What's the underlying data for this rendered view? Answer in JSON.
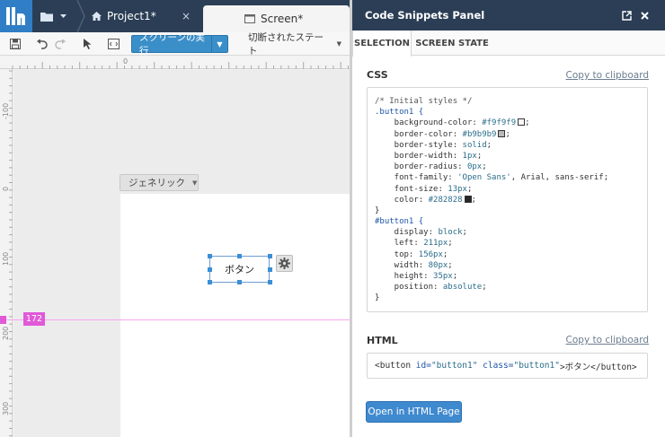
{
  "app": {
    "project_tab": "Project1*",
    "screen_tab": "Screen*",
    "close_glyph": "×"
  },
  "toolbar": {
    "run_label": "スクリーンの実行",
    "state_label": "切断されたステート"
  },
  "canvas": {
    "ruler_top_zero": "0",
    "ruler_left_labels": [
      "-100",
      "0",
      "100",
      "200",
      "300"
    ],
    "device_dropdown": "ジェネリック",
    "button_text": "ボタン",
    "guide_value": "172"
  },
  "panel": {
    "title": "Code Snippets Panel",
    "tabs": [
      "SELECTION",
      "SCREEN STATE"
    ],
    "css_title": "CSS",
    "html_title": "HTML",
    "copy_label": "Copy to clipboard",
    "open_label": "Open in HTML Page",
    "css_lines": [
      {
        "kind": "comment",
        "text": "/* Initial styles */"
      },
      {
        "kind": "selector",
        "text": ".button1 {"
      },
      {
        "kind": "decl",
        "prop": "    background-color: ",
        "value": "#f9f9f9",
        "swatch": "#f9f9f9",
        "end": ";"
      },
      {
        "kind": "decl",
        "prop": "    border-color: ",
        "value": "#b9b9b9",
        "swatch": "#b9b9b9",
        "end": ";"
      },
      {
        "kind": "decl",
        "prop": "    border-style: ",
        "value": "solid",
        "end": ";"
      },
      {
        "kind": "decl",
        "prop": "    border-width: ",
        "value": "1px",
        "end": ";"
      },
      {
        "kind": "decl",
        "prop": "    border-radius: ",
        "value": "0px",
        "end": ";"
      },
      {
        "kind": "decl",
        "prop": "    font-family: ",
        "value": "'Open Sans'",
        "tail": ", Arial, sans-serif",
        "end": ";"
      },
      {
        "kind": "decl",
        "prop": "    font-size: ",
        "value": "13px",
        "end": ";"
      },
      {
        "kind": "decl",
        "prop": "    color: ",
        "value": "#282828",
        "swatch": "#282828",
        "end": ";"
      },
      {
        "kind": "plain",
        "text": "}"
      },
      {
        "kind": "selector",
        "text": "#button1 {"
      },
      {
        "kind": "decl",
        "prop": "    display: ",
        "value": "block",
        "end": ";"
      },
      {
        "kind": "decl",
        "prop": "    left: ",
        "value": "211px",
        "end": ";"
      },
      {
        "kind": "decl",
        "prop": "    top: ",
        "value": "156px",
        "end": ";"
      },
      {
        "kind": "decl",
        "prop": "    width: ",
        "value": "80px",
        "end": ";"
      },
      {
        "kind": "decl",
        "prop": "    height: ",
        "value": "35px",
        "end": ";"
      },
      {
        "kind": "decl",
        "prop": "    position: ",
        "value": "absolute",
        "end": ";"
      },
      {
        "kind": "plain",
        "text": "}"
      }
    ],
    "html_snippet": {
      "open": "<button ",
      "attr1": "id=",
      "val1": "\"button1\"",
      "attr2": " class=",
      "val2": "\"button1\"",
      "inner": ">ボタン</button>"
    }
  },
  "colors": {
    "header_bg": "#2b3e55",
    "accent": "#3a8fc9",
    "guide": "#e05ad8"
  }
}
